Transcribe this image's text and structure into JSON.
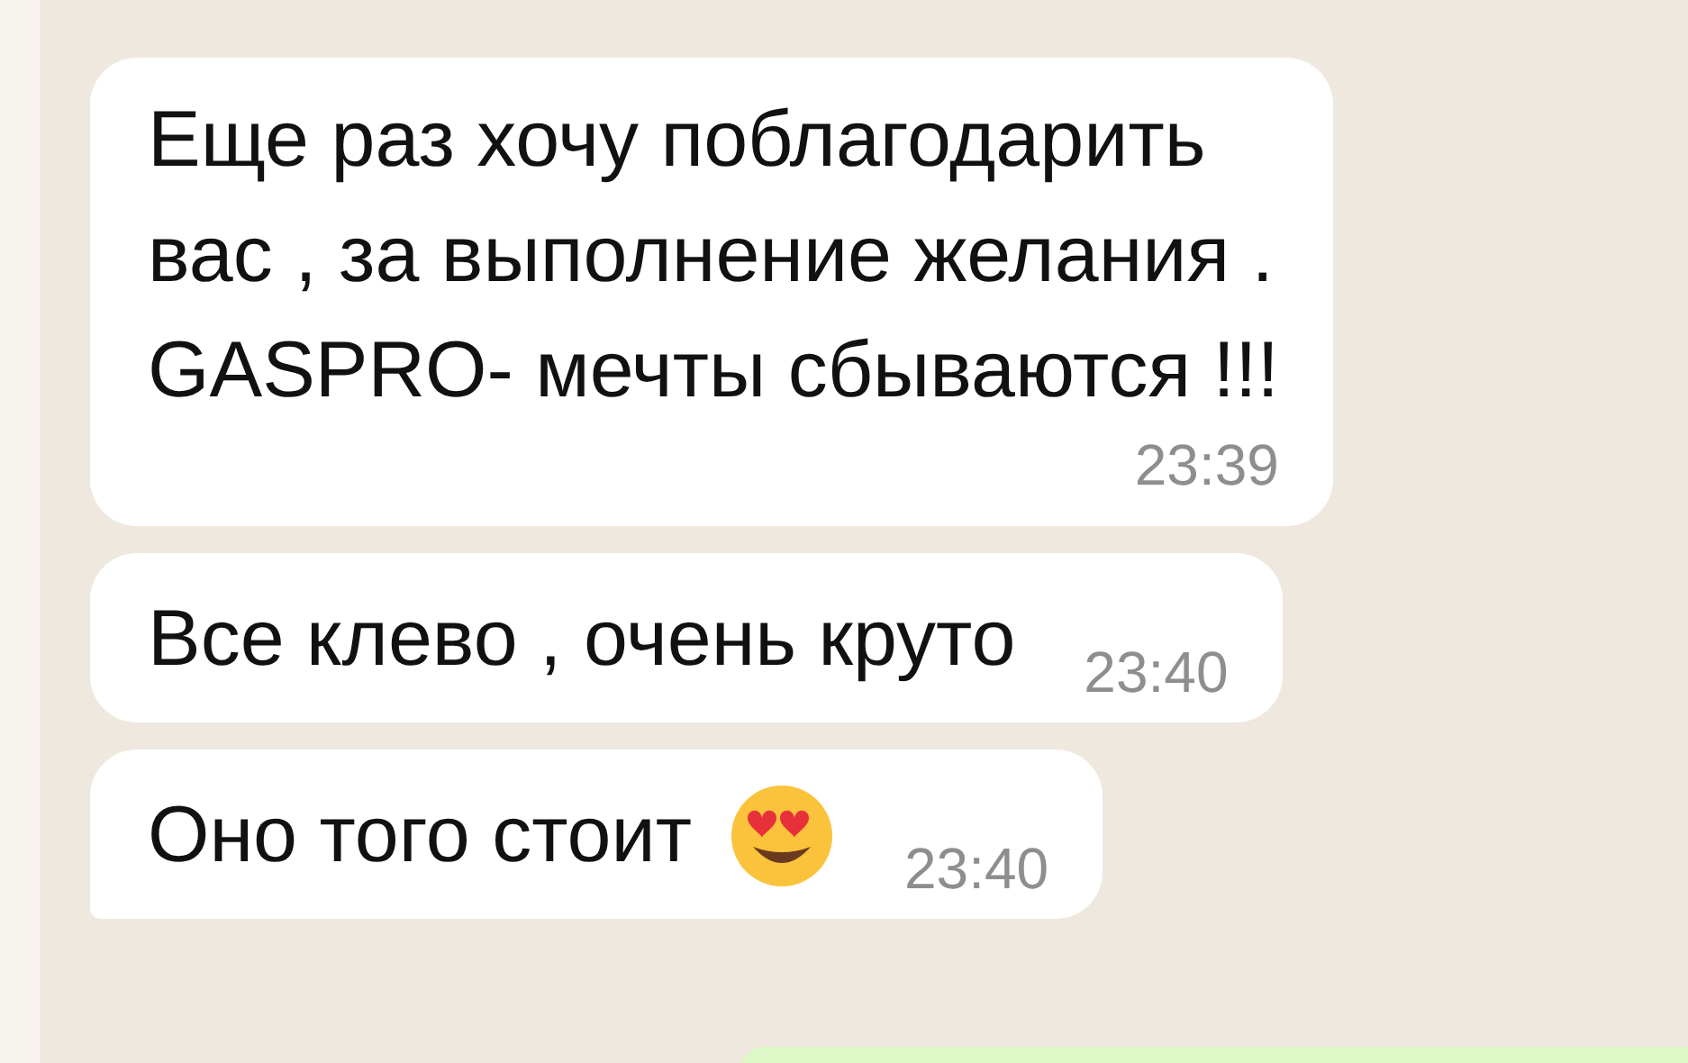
{
  "messages": [
    {
      "kind": "long",
      "text": "Еще раз хочу поблагодарить\nвас , за выполнение желания .\nGASPRO- мечты сбываются !!!",
      "time": "23:39"
    },
    {
      "kind": "short",
      "text": "Все клево , очень круто",
      "time": "23:40"
    },
    {
      "kind": "short_emoji",
      "text": "Оно того стоит",
      "time": "23:40"
    }
  ]
}
